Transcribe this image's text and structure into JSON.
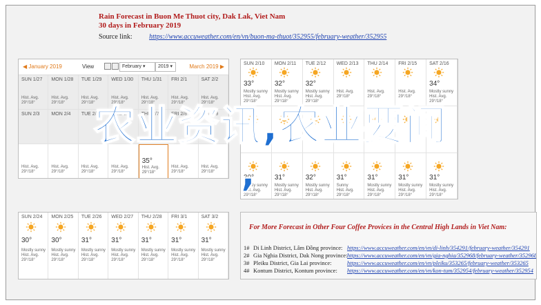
{
  "header": {
    "title": "Rain Forecast in Buon Me Thuot city, Dak Lak, Viet Nam",
    "subtitle": "30 days in February 2019",
    "source_label": "Source link:",
    "source_url": "https://www.accuweather.com/en/vn/buon-ma-thuot/352955/february-weather/352955"
  },
  "calendar_nav": {
    "prev_month": "◀ January 2019",
    "view_label": "View",
    "month_select": "February ▾",
    "year_select": "2019 ▾",
    "next_month": "March 2019 ▶"
  },
  "panel_a": {
    "cells": [
      {
        "day": "SUN 1/27",
        "temp": "",
        "desc": "Hist. Avg.\n29°/18°",
        "past": true
      },
      {
        "day": "MON 1/28",
        "temp": "",
        "desc": "Hist. Avg.\n29°/18°",
        "past": true
      },
      {
        "day": "TUE 1/29",
        "temp": "",
        "desc": "Hist. Avg.\n29°/18°",
        "past": true
      },
      {
        "day": "WED 1/30",
        "temp": "",
        "desc": "Hist. Avg.\n29°/18°",
        "past": true
      },
      {
        "day": "THU 1/31",
        "temp": "",
        "desc": "Hist. Avg.\n29°/18°",
        "past": true
      },
      {
        "day": "FRI 2/1",
        "temp": "",
        "desc": "Hist. Avg.\n29°/18°",
        "past": true
      },
      {
        "day": "SAT 2/2",
        "temp": "",
        "desc": "Hist. Avg.\n29°/18°",
        "past": true
      },
      {
        "day": "SUN 2/3",
        "temp": "",
        "desc": "",
        "past": true
      },
      {
        "day": "MON 2/4",
        "temp": "",
        "desc": "",
        "past": true
      },
      {
        "day": "TUE 2/5",
        "temp": "",
        "desc": "",
        "past": true
      },
      {
        "day": "WED 2/6",
        "temp": "",
        "desc": "",
        "past": true
      },
      {
        "day": "THU 2/7",
        "temp": "",
        "desc": "",
        "past": true
      },
      {
        "day": "FRI 2/8",
        "temp": "",
        "desc": "",
        "past": true
      },
      {
        "day": "SAT 2/9",
        "temp": "",
        "desc": "",
        "past": true
      },
      {
        "day": "",
        "temp": "",
        "desc": "Hist. Avg.\n29°/18°",
        "past": false
      },
      {
        "day": "",
        "temp": "",
        "desc": "Hist. Avg.\n29°/18°",
        "past": false
      },
      {
        "day": "",
        "temp": "",
        "desc": "Hist. Avg.\n29°/18°",
        "past": false
      },
      {
        "day": "",
        "temp": "",
        "desc": "Hist. Avg.\n29°/18°",
        "past": false
      },
      {
        "day": "",
        "temp": "35°",
        "desc": "Hist. Avg.\n29°/18°",
        "past": false,
        "today": true
      },
      {
        "day": "",
        "temp": "",
        "desc": "Hist. Avg.\n29°/18°",
        "past": false
      },
      {
        "day": "",
        "temp": "",
        "desc": "Hist. Avg.\n29°/18°",
        "past": false
      }
    ]
  },
  "panel_b": {
    "cells": [
      {
        "day": "SUN 2/10",
        "temp": "33°",
        "desc": "Mostly sunny\nHist. Avg.\n29°/18°"
      },
      {
        "day": "MON 2/11",
        "temp": "32°",
        "desc": "Mostly sunny\nHist. Avg.\n29°/18°"
      },
      {
        "day": "TUE 2/12",
        "temp": "32°",
        "desc": "Mostly sunny\nHist. Avg.\n29°/18°"
      },
      {
        "day": "WED 2/13",
        "temp": "",
        "desc": "Hist. Avg.\n29°/18°"
      },
      {
        "day": "THU 2/14",
        "temp": "",
        "desc": "Hist. Avg.\n29°/18°"
      },
      {
        "day": "FRI 2/15",
        "temp": "",
        "desc": "Hist. Avg.\n29°/18°"
      },
      {
        "day": "SAT 2/16",
        "temp": "34°",
        "desc": "Mostly sunny\nHist. Avg.\n29°/18°"
      },
      {
        "day": "",
        "temp": "",
        "desc": ""
      },
      {
        "day": "",
        "temp": "",
        "desc": ""
      },
      {
        "day": "",
        "temp": "",
        "desc": ""
      },
      {
        "day": "",
        "temp": "",
        "desc": ""
      },
      {
        "day": "",
        "temp": "",
        "desc": ""
      },
      {
        "day": "",
        "temp": "",
        "desc": ""
      },
      {
        "day": "",
        "temp": "",
        "desc": ""
      },
      {
        "day": "",
        "temp": "30°",
        "desc": "Mostly sunny\nHist. Avg.\n29°/18°"
      },
      {
        "day": "",
        "temp": "31°",
        "desc": "Mostly sunny\nHist. Avg.\n29°/18°"
      },
      {
        "day": "",
        "temp": "32°",
        "desc": "Mostly sunny\nHist. Avg.\n29°/18°"
      },
      {
        "day": "",
        "temp": "31°",
        "desc": "Sunny\nHist. Avg.\n29°/18°"
      },
      {
        "day": "",
        "temp": "31°",
        "desc": "Mostly sunny\nHist. Avg.\n29°/18°"
      },
      {
        "day": "",
        "temp": "31°",
        "desc": "Mostly sunny\nHist. Avg.\n29°/18°"
      },
      {
        "day": "",
        "temp": "31°",
        "desc": "Mostly sunny\nHist. Avg.\n29°/18°"
      }
    ]
  },
  "panel_c": {
    "cells": [
      {
        "day": "SUN 2/24",
        "temp": "30°",
        "desc": "Mostly sunny\nHist. Avg.\n29°/18°"
      },
      {
        "day": "MON 2/25",
        "temp": "30°",
        "desc": "Mostly sunny\nHist. Avg.\n29°/18°"
      },
      {
        "day": "TUE 2/26",
        "temp": "31°",
        "desc": "Mostly sunny\nHist. Avg.\n29°/18°"
      },
      {
        "day": "WED 2/27",
        "temp": "31°",
        "desc": "Mostly sunny\nHist. Avg.\n29°/18°"
      },
      {
        "day": "THU 2/28",
        "temp": "31°",
        "desc": "Mostly sunny\nHist. Avg.\n29°/18°"
      },
      {
        "day": "FRI 3/1",
        "temp": "31°",
        "desc": "Mostly sunny\nHist. Avg.\n29°/18°"
      },
      {
        "day": "SAT 3/2",
        "temp": "31°",
        "desc": "Mostly sunny\nHist. Avg.\n29°/18°"
      }
    ]
  },
  "more_forecast": {
    "title": "For More Forecast in Other Four Coffee Provices in the Central High Lands in Viet Nam:",
    "rows": [
      {
        "num": "1#",
        "name": "Di Linh District, Lâm Đồng province:",
        "url": "https://www.accuweather.com/en/vn/di-linh/354291/february-weather/354291"
      },
      {
        "num": "2#",
        "name": "Gia Nghia District, Dak Nong province:",
        "url": "https://www.accuweather.com/en/vn/gia-nghia/352968/february-weather/352968"
      },
      {
        "num": "3#",
        "name": "Pleiku District, Gia Lai province:",
        "url": "https://www.accuweather.com/en/vn/pleiku/353265/february-weather/353265"
      },
      {
        "num": "4#",
        "name": "Kontum District, Kontum province:",
        "url": "https://www.accuweather.com/en/vn/kon-tum/352954/february-weather/352954"
      }
    ]
  },
  "watermark": {
    "line1": "农业资讯,农业要闻",
    "line2": ","
  },
  "colors": {
    "title_red": "#b11c1c",
    "link_blue": "#1a3fb0",
    "accent_orange": "#e07a1a",
    "sun_yellow": "#f5a623",
    "watermark_blue": "#1f6fd1"
  }
}
